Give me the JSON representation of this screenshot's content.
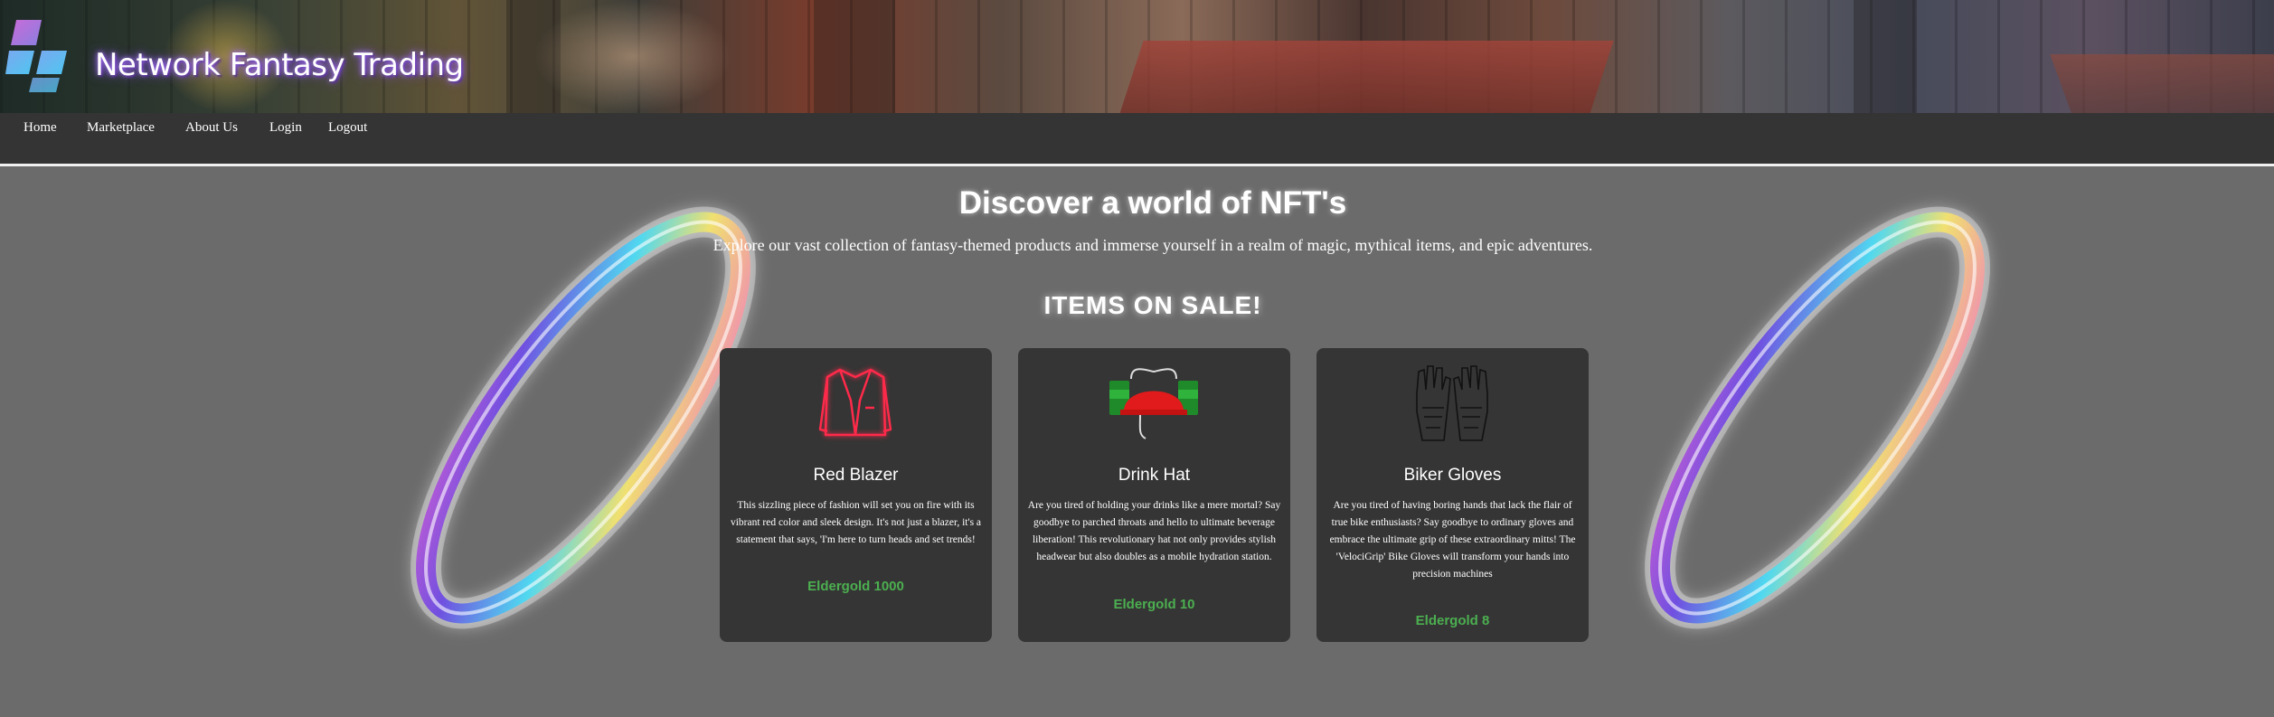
{
  "header": {
    "title": "Network Fantasy Trading",
    "logo_icon": "stacked-squares-logo-icon"
  },
  "nav": {
    "items": [
      "Home",
      "Marketplace",
      "About Us",
      "Login",
      "Logout"
    ]
  },
  "hero": {
    "headline": "Discover a world of NFT's",
    "subheadline": "Explore our vast collection of fantasy-themed products and immerse yourself in a realm of magic, mythical items, and epic adventures."
  },
  "sale": {
    "heading": "ITEMS ON SALE!",
    "items": [
      {
        "name": "Red Blazer",
        "description": "This sizzling piece of fashion will set you on fire with its vibrant red color and sleek design. It's not just a blazer, it's a statement that says, 'I'm here to turn heads and set trends!",
        "price": "Eldergold 1000",
        "icon": "neon-blazer-icon"
      },
      {
        "name": "Drink Hat",
        "description": "Are you tired of holding your drinks like a mere mortal? Say goodbye to parched throats and hello to ultimate beverage liberation! This revolutionary hat not only provides stylish headwear but also doubles as a mobile hydration station.",
        "price": "Eldergold 10",
        "icon": "drink-hat-icon"
      },
      {
        "name": "Biker Gloves",
        "description": "Are you tired of having boring hands that lack the flair of true bike enthusiasts? Say goodbye to ordinary gloves and embrace the ultimate grip of these extraordinary mitts! The 'VelociGrip' Bike Gloves will transform your hands into precision machines",
        "price": "Eldergold 8",
        "icon": "biker-gloves-icon"
      }
    ]
  },
  "colors": {
    "page_bg": "#6b6b6b",
    "nav_bg": "#343434",
    "card_bg": "#353535",
    "price": "#4caf50"
  }
}
